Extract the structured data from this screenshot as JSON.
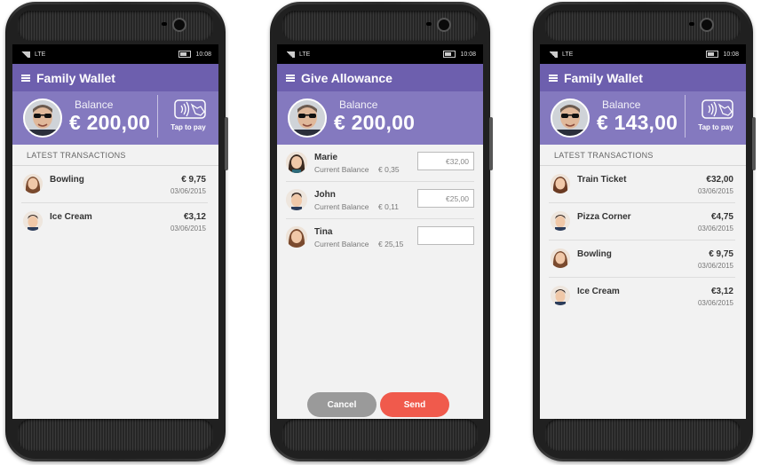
{
  "status": {
    "network": "LTE",
    "time": "10:08"
  },
  "screens": {
    "wallet1": {
      "title": "Family Wallet",
      "balance_label": "Balance",
      "balance": "€ 200,00",
      "tap_label": "Tap to pay",
      "section": "LATEST TRANSACTIONS",
      "transactions": [
        {
          "name": "Bowling",
          "amount": "€ 9,75",
          "date": "03/06/2015"
        },
        {
          "name": "Ice Cream",
          "amount": "€3,12",
          "date": "03/06/2015"
        }
      ]
    },
    "allowance": {
      "title": "Give Allowance",
      "balance_label": "Balance",
      "balance": "€ 200,00",
      "current_balance_label": "Current Balance",
      "kids": [
        {
          "name": "Marie",
          "balance": "€ 0,35",
          "input": "€32,00"
        },
        {
          "name": "John",
          "balance": "€ 0,11",
          "input": "€25,00"
        },
        {
          "name": "Tina",
          "balance": "€ 25,15",
          "input": ""
        }
      ],
      "cancel": "Cancel",
      "send": "Send"
    },
    "wallet2": {
      "title": "Family Wallet",
      "balance_label": "Balance",
      "balance": "€ 143,00",
      "tap_label": "Tap to pay",
      "section": "LATEST TRANSACTIONS",
      "transactions": [
        {
          "name": "Train Ticket",
          "amount": "€32,00",
          "date": "03/06/2015"
        },
        {
          "name": "Pizza Corner",
          "amount": "€4,75",
          "date": "03/06/2015"
        },
        {
          "name": "Bowling",
          "amount": "€ 9,75",
          "date": "03/06/2015"
        },
        {
          "name": "Ice Cream",
          "amount": "€3,12",
          "date": "03/06/2015"
        }
      ]
    }
  },
  "colors": {
    "appbar": "#6d5fae",
    "balance_panel": "#8479bf",
    "send": "#f05a4c",
    "cancel": "#9a9a9a"
  }
}
